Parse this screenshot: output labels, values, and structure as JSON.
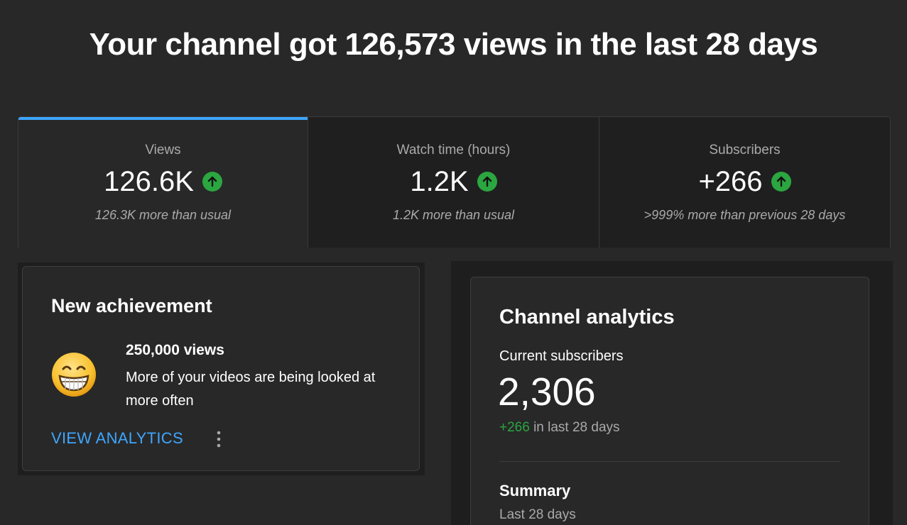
{
  "header": {
    "headline": "Your channel got 126,573 views in the last 28 days"
  },
  "metrics": {
    "tabs": [
      {
        "label": "Views",
        "value": "126.6K",
        "note": "126.3K more than usual",
        "trend": "up",
        "active": true
      },
      {
        "label": "Watch time (hours)",
        "value": "1.2K",
        "note": "1.2K more than usual",
        "trend": "up",
        "active": false
      },
      {
        "label": "Subscribers",
        "value": "+266",
        "note": ">999% more than previous 28 days",
        "trend": "up",
        "active": false
      }
    ],
    "trend_icon": "arrow-up-circle-icon",
    "trend_color": "#2ba640",
    "active_color": "#3ea6ff"
  },
  "achievement": {
    "title": "New achievement",
    "icon": "grinning-face-emoji-icon",
    "headline": "250,000 views",
    "description": "More of your videos are being looked at more often",
    "action_label": "VIEW ANALYTICS",
    "more_icon": "more-vert-icon"
  },
  "analytics": {
    "title": "Channel analytics",
    "current_subscribers_label": "Current subscribers",
    "current_subscribers": "2,306",
    "delta": "+266",
    "delta_suffix": "in last 28 days",
    "summary_title": "Summary",
    "summary_period": "Last 28 days"
  }
}
